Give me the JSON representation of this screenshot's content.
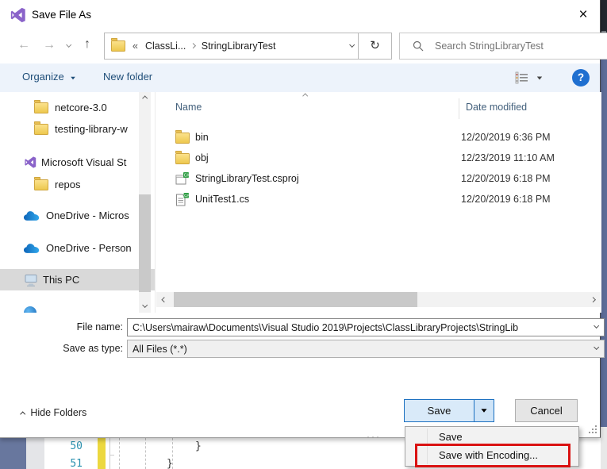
{
  "window": {
    "title": "Save File As"
  },
  "glyphs": {
    "back": "←",
    "forward": "→",
    "up": "↑",
    "refresh": "↻",
    "close": "×",
    "help": "?",
    "overflow": "«",
    "dots": "···"
  },
  "nav": {
    "breadcrumb_root": "ClassLi...",
    "breadcrumb_current": "StringLibraryTest",
    "search_placeholder": "Search StringLibraryTest"
  },
  "toolbar": {
    "organize": "Organize",
    "new_folder": "New folder"
  },
  "sidebar": {
    "items": [
      {
        "label": "netcore-3.0",
        "icon": "folder"
      },
      {
        "label": "testing-library-w",
        "icon": "folder"
      },
      {
        "label": "Microsoft Visual St",
        "icon": "visual-studio"
      },
      {
        "label": "repos",
        "icon": "folder"
      },
      {
        "label": "OneDrive - Micros",
        "icon": "onedrive-cloud"
      },
      {
        "label": "OneDrive - Person",
        "icon": "onedrive-cloud"
      },
      {
        "label": "This PC",
        "icon": "this-pc",
        "selected": true
      }
    ]
  },
  "filelist": {
    "columns": [
      "Name",
      "Date modified"
    ],
    "rows": [
      {
        "name": "bin",
        "icon": "folder",
        "date": "12/20/2019 6:36 PM"
      },
      {
        "name": "obj",
        "icon": "folder",
        "date": "12/23/2019 11:10 AM"
      },
      {
        "name": "StringLibraryTest.csproj",
        "icon": "csharp-project",
        "date": "12/20/2019 6:18 PM"
      },
      {
        "name": "UnitTest1.cs",
        "icon": "csharp-file",
        "date": "12/20/2019 6:18 PM"
      }
    ]
  },
  "fields": {
    "file_name_label": "File name:",
    "file_name_value": "C:\\Users\\mairaw\\Documents\\Visual Studio 2019\\Projects\\ClassLibraryProjects\\StringLib",
    "save_as_type_label": "Save as type:",
    "save_as_type_value": "All Files (*.*)"
  },
  "footer": {
    "hide_folders": "Hide Folders",
    "save_label": "Save",
    "cancel_label": "Cancel"
  },
  "menu": {
    "items": [
      {
        "label": "Save"
      },
      {
        "label": "Save with Encoding..."
      }
    ]
  },
  "editor": {
    "line_numbers": [
      "50",
      "51"
    ],
    "code_lines": [
      "}",
      "}"
    ]
  },
  "colors": {
    "accent_blue": "#1f6fd0",
    "highlight_red": "#da1212",
    "selection_gray": "#d9d9d9",
    "toolbar_bg": "#edf3fb",
    "vs_purple": "#8a63c9",
    "save_button_fill": "#d9eaf9"
  }
}
